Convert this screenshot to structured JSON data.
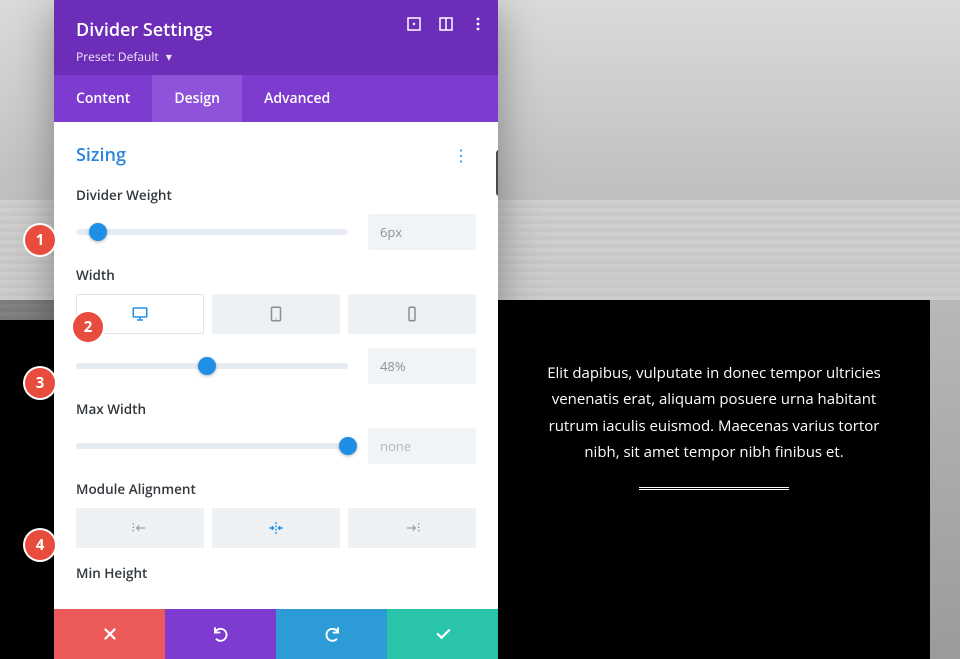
{
  "header": {
    "title": "Divider Settings",
    "preset_label": "Preset:",
    "preset_value": "Default",
    "icons": {
      "expand": "expand-icon",
      "columns": "responsive-icon",
      "more": "more-icon"
    }
  },
  "tabs": {
    "content": "Content",
    "design": "Design",
    "advanced": "Advanced",
    "active": "design"
  },
  "section": {
    "title": "Sizing"
  },
  "controls": {
    "divider_weight": {
      "label": "Divider Weight",
      "value": "6px",
      "percent": 8
    },
    "width": {
      "label": "Width",
      "value": "48%",
      "percent": 48,
      "devices": {
        "desktop": "desktop",
        "tablet": "tablet",
        "phone": "phone",
        "active": "desktop"
      }
    },
    "max_width": {
      "label": "Max Width",
      "value": "none",
      "percent": 100
    },
    "module_alignment": {
      "label": "Module Alignment",
      "options": {
        "left": "left",
        "center": "center",
        "right": "right"
      },
      "active": "center"
    },
    "min_height": {
      "label": "Min Height"
    }
  },
  "footer": {
    "cancel": "Cancel",
    "undo": "Undo",
    "redo": "Redo",
    "save": "Save"
  },
  "callouts": {
    "c1": "1",
    "c2": "2",
    "c3": "3",
    "c4": "4"
  },
  "preview": {
    "paragraph": "Elit dapibus, vulputate in donec tempor ultricies venenatis erat, aliquam posuere urna habitant rutrum iaculis euismod. Maecenas varius tortor nibh, sit amet tempor nibh finibus et."
  }
}
